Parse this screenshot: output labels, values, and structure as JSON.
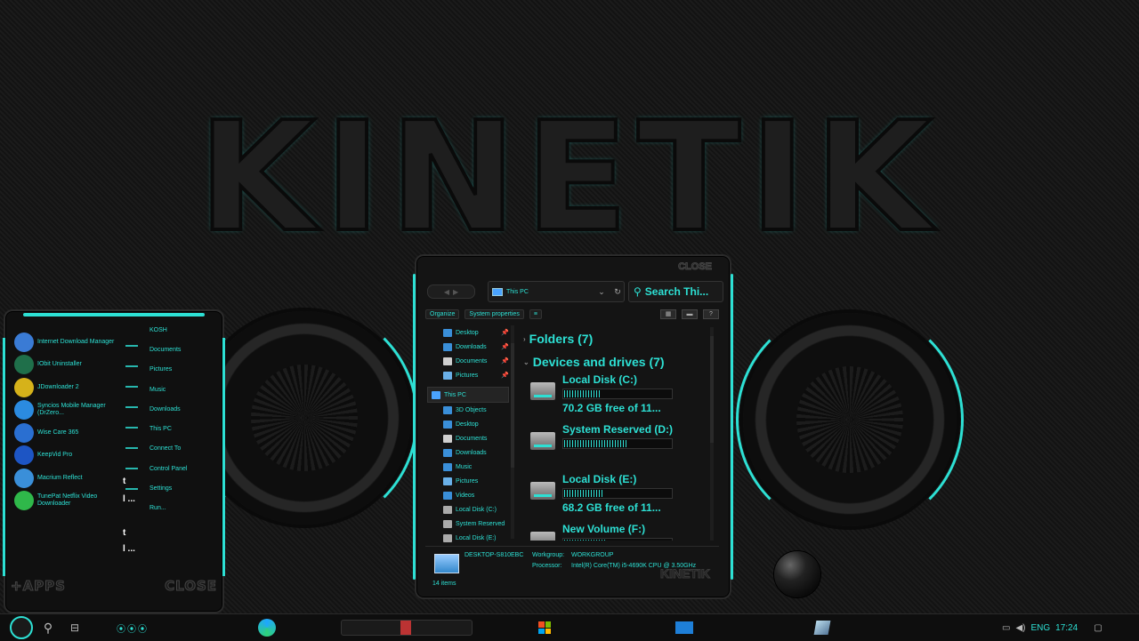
{
  "wallpaper": {
    "logo_text": "KINETIK"
  },
  "start_menu": {
    "apps": [
      {
        "label": "Internet Download Manager",
        "icon": "idm-icon",
        "color": "#3a7bd5"
      },
      {
        "label": "IObit Uninstaller",
        "icon": "iobit-uninstaller-icon",
        "color": "#1f6f4a"
      },
      {
        "label": "JDownloader 2",
        "icon": "jdownloader-icon",
        "color": "#d6b21a"
      },
      {
        "label": "Syncios Mobile Manager (DrZero...",
        "icon": "syncios-icon",
        "color": "#2b8be0"
      },
      {
        "label": "Wise Care 365",
        "icon": "wise-care-icon",
        "color": "#2a6fd1"
      },
      {
        "label": "KeepVid Pro",
        "icon": "keepvid-icon",
        "color": "#1d55c4"
      },
      {
        "label": "Macrium Reflect",
        "icon": "macrium-icon",
        "color": "#3a8fd9"
      },
      {
        "label": "TunePat Netflix Video Downloader",
        "icon": "tunepat-icon",
        "color": "#2fb84a"
      }
    ],
    "places": [
      "KOSH",
      "Documents",
      "Pictures",
      "Music",
      "Downloads",
      "This PC",
      "Connect To",
      "Control Panel",
      "Settings",
      "Run..."
    ],
    "all_apps_label": "+APPS",
    "close_label": "CLOSE"
  },
  "explorer": {
    "brand": "CLOSE",
    "address": "This PC",
    "search_placeholder": "Search Thi...",
    "toolbar": {
      "organize": "Organize",
      "system_properties": "System properties"
    },
    "nav": [
      {
        "label": "Desktop",
        "icon_color": "#3a8fd9",
        "pinned": true
      },
      {
        "label": "Downloads",
        "icon_color": "#3a8fd9",
        "pinned": true
      },
      {
        "label": "Documents",
        "icon_color": "#cfcfcf",
        "pinned": true
      },
      {
        "label": "Pictures",
        "icon_color": "#6ab0e8",
        "pinned": true
      },
      {
        "label": "This PC",
        "icon_color": "#4aa3ff",
        "selected": true
      },
      {
        "label": "3D Objects",
        "icon_color": "#3a8fd9"
      },
      {
        "label": "Desktop",
        "icon_color": "#3a8fd9"
      },
      {
        "label": "Documents",
        "icon_color": "#cfcfcf"
      },
      {
        "label": "Downloads",
        "icon_color": "#3a8fd9"
      },
      {
        "label": "Music",
        "icon_color": "#3a8fd9"
      },
      {
        "label": "Pictures",
        "icon_color": "#6ab0e8"
      },
      {
        "label": "Videos",
        "icon_color": "#3a8fd9"
      },
      {
        "label": "Local Disk (C:)",
        "icon_color": "#aaaaaa"
      },
      {
        "label": "System Reserved",
        "icon_color": "#aaaaaa"
      },
      {
        "label": "Local Disk (E:)",
        "icon_color": "#aaaaaa"
      }
    ],
    "groups": {
      "folders": "Folders (7)",
      "devices": "Devices and drives (7)"
    },
    "drives": [
      {
        "name": "Local Disk (C:)",
        "free": "70.2 GB free of 11...",
        "used_fraction": 0.35
      },
      {
        "name": "System Reserved (D:)",
        "free": "",
        "used_fraction": 0.6
      },
      {
        "name": "Local Disk (E:)",
        "free": "68.2 GB free of 11...",
        "used_fraction": 0.36
      },
      {
        "name": "New Volume (F:)",
        "free": "",
        "used_fraction": 0.4
      }
    ],
    "details": {
      "computer_name": "DESKTOP-S810EBC",
      "workgroup_label": "Workgroup:",
      "workgroup": "WORKGROUP",
      "processor_label": "Processor:",
      "processor": "Intel(R) Core(TM) i5-4690K CPU @ 3.50GHz",
      "items": "14 items",
      "brand": "KINETIK"
    }
  },
  "taskbar": {
    "tray": {
      "language": "ENG",
      "time": "17:24"
    }
  },
  "colors": {
    "accent": "#2de0d4",
    "background": "#161616"
  }
}
